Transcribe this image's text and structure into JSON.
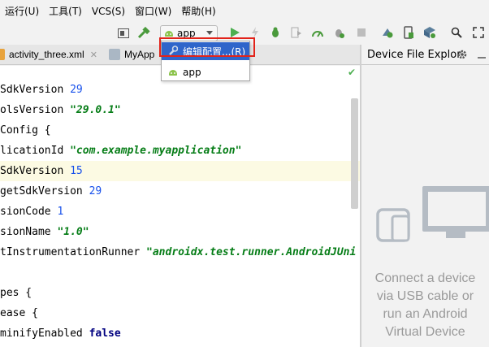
{
  "menubar": {
    "items": [
      "运行(U)",
      "工具(T)",
      "VCS(S)",
      "窗口(W)",
      "帮助(H)"
    ]
  },
  "toolbar": {
    "config_label": "app",
    "icons": [
      "layout-icon",
      "build-hammer-icon",
      "run-icon",
      "apply-changes-icon",
      "debug-icon",
      "coverage-icon",
      "profile-icon",
      "attach-debugger-icon",
      "stop-icon",
      "sync-gradle-icon",
      "avd-manager-icon",
      "sdk-manager-icon",
      "search-icon",
      "fullscreen-icon"
    ]
  },
  "tabs": [
    {
      "label": "activity_three.xml",
      "close": "✕"
    },
    {
      "label": "MyApp",
      "close": "✕"
    }
  ],
  "dropdown": {
    "items": [
      {
        "label": "编辑配置...(R)",
        "selected": true
      },
      {
        "label": "app",
        "selected": false
      }
    ]
  },
  "editor": {
    "lines": [
      {
        "plain": "SdkVersion ",
        "num": "29"
      },
      {
        "plain": "olsVersion ",
        "str": "\"29.0.1\""
      },
      {
        "plain": "Config {"
      },
      {
        "plain": "licationId ",
        "str": "\"com.example.myapplication\""
      },
      {
        "plain": "SdkVersion ",
        "num": "15",
        "highlight": true
      },
      {
        "plain": "getSdkVersion ",
        "num": "29"
      },
      {
        "plain": "sionCode ",
        "num": "1"
      },
      {
        "plain": "sionName ",
        "str": "\"1.0\""
      },
      {
        "plain": "tInstrumentationRunner ",
        "str": "\"androidx.test.runner.AndroidJUni"
      },
      {
        "plain": ""
      },
      {
        "plain": "pes {"
      },
      {
        "plain": "ease {"
      },
      {
        "plain": "  minifyEnabled ",
        "kw": "false"
      }
    ]
  },
  "device_file_explorer": {
    "title": "Device File Explor",
    "message_lines": [
      "Connect a device",
      "via USB cable or",
      "run an Android",
      "Virtual Device"
    ]
  },
  "colors": {
    "selection": "#2f65ca",
    "annotation_red": "#e2231a",
    "number": "#1750eb",
    "string": "#067d17",
    "keyword": "#000080"
  }
}
